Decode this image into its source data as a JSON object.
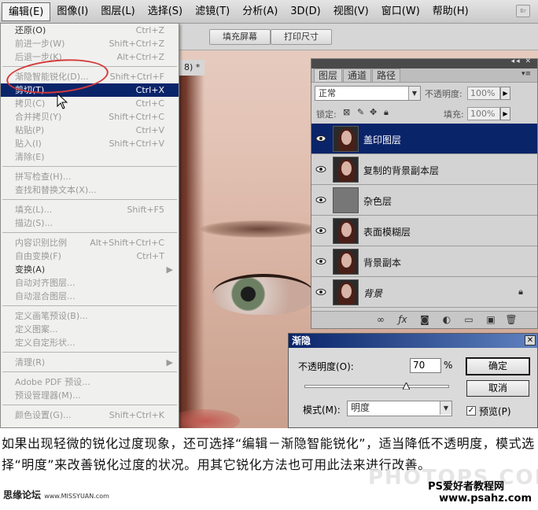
{
  "menubar": {
    "items": [
      "编辑(E)",
      "图像(I)",
      "图层(L)",
      "选择(S)",
      "滤镜(T)",
      "分析(A)",
      "3D(D)",
      "视图(V)",
      "窗口(W)",
      "帮助(H)"
    ],
    "app_button": "Br"
  },
  "options_bar": {
    "fill_screen": "填充屏幕",
    "print_size": "打印尺寸"
  },
  "document_tab": "8) *",
  "edit_menu": {
    "items": [
      {
        "label": "还原(O)",
        "shortcut": "Ctrl+Z",
        "state": "enabled"
      },
      {
        "label": "前进一步(W)",
        "shortcut": "Shift+Ctrl+Z",
        "state": "disabled"
      },
      {
        "label": "后退一步(K)",
        "shortcut": "Alt+Ctrl+Z",
        "state": "disabled"
      },
      {
        "label": "渐隐智能锐化(D)...",
        "shortcut": "Shift+Ctrl+F",
        "state": "disabled"
      },
      {
        "label": "剪切(T)",
        "shortcut": "Ctrl+X",
        "state": "highlighted"
      },
      {
        "label": "拷贝(C)",
        "shortcut": "Ctrl+C",
        "state": "disabled"
      },
      {
        "label": "合并拷贝(Y)",
        "shortcut": "Shift+Ctrl+C",
        "state": "disabled"
      },
      {
        "label": "粘贴(P)",
        "shortcut": "Ctrl+V",
        "state": "disabled"
      },
      {
        "label": "贴入(I)",
        "shortcut": "Shift+Ctrl+V",
        "state": "disabled"
      },
      {
        "label": "清除(E)",
        "shortcut": "",
        "state": "disabled"
      },
      {
        "label": "拼写检查(H)...",
        "shortcut": "",
        "state": "disabled"
      },
      {
        "label": "查找和替换文本(X)...",
        "shortcut": "",
        "state": "disabled"
      },
      {
        "label": "填充(L)...",
        "shortcut": "Shift+F5",
        "state": "disabled"
      },
      {
        "label": "描边(S)...",
        "shortcut": "",
        "state": "disabled"
      },
      {
        "label": "内容识别比例",
        "shortcut": "Alt+Shift+Ctrl+C",
        "state": "disabled"
      },
      {
        "label": "自由变换(F)",
        "shortcut": "Ctrl+T",
        "state": "disabled"
      },
      {
        "label": "变换(A)",
        "shortcut": "",
        "state": "enabled",
        "submenu": true
      },
      {
        "label": "自动对齐图层...",
        "shortcut": "",
        "state": "disabled"
      },
      {
        "label": "自动混合图层...",
        "shortcut": "",
        "state": "disabled"
      },
      {
        "label": "定义画笔预设(B)...",
        "shortcut": "",
        "state": "disabled"
      },
      {
        "label": "定义图案...",
        "shortcut": "",
        "state": "disabled"
      },
      {
        "label": "定义自定形状...",
        "shortcut": "",
        "state": "disabled"
      },
      {
        "label": "清理(R)",
        "shortcut": "",
        "state": "disabled",
        "submenu": true
      },
      {
        "label": "Adobe PDF 预设...",
        "shortcut": "",
        "state": "disabled"
      },
      {
        "label": "预设管理器(M)...",
        "shortcut": "",
        "state": "disabled"
      },
      {
        "label": "颜色设置(G)...",
        "shortcut": "Shift+Ctrl+K",
        "state": "disabled"
      }
    ]
  },
  "layers_panel": {
    "tabs": [
      "图层",
      "通道",
      "路径"
    ],
    "blend_mode": "正常",
    "opacity_label": "不透明度:",
    "opacity_value": "100%",
    "lock_label": "锁定:",
    "fill_label": "填充:",
    "fill_value": "100%",
    "layers": [
      {
        "name": "盖印图层",
        "selected": true,
        "thumb": "portrait"
      },
      {
        "name": "复制的背景副本层",
        "selected": false,
        "thumb": "portrait"
      },
      {
        "name": "杂色层",
        "selected": false,
        "thumb": "gray"
      },
      {
        "name": "表面模糊层",
        "selected": false,
        "thumb": "portrait"
      },
      {
        "name": "背景副本",
        "selected": false,
        "thumb": "portrait"
      },
      {
        "name": "背景",
        "selected": false,
        "thumb": "portrait",
        "locked": true
      }
    ]
  },
  "fade_dialog": {
    "title": "渐隐",
    "opacity_label": "不透明度(O):",
    "opacity_value": "70",
    "percent": "%",
    "slider_fraction": 0.7,
    "mode_label": "模式(M):",
    "mode_value": "明度",
    "ok": "确定",
    "cancel": "取消",
    "preview_label": "预览(P)",
    "preview_checked": true
  },
  "caption": {
    "text": "如果出现轻微的锐化过度现象，还可选择“编辑－渐隐智能锐化”，适当降低不透明度，模式选择“明度”来改善锐化过度的状况。用其它锐化方法也可用此法来进行改善。"
  },
  "watermarks": {
    "left": "思缘论坛",
    "left_url": "www.MISSYUAN.com",
    "center": "PHOTOPS.COM",
    "right_line1": "PS爱好者教程网",
    "right_line2": "www.psahz.com"
  },
  "colors": {
    "menu_highlight": "#0a246a",
    "annotation": "#d43a3a"
  }
}
